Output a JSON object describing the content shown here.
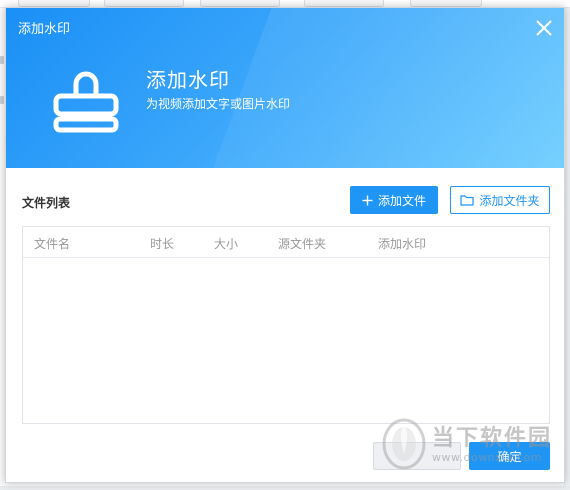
{
  "dialog": {
    "title": "添加水印",
    "heading": "添加水印",
    "subtitle": "为视频添加文字或图片水印",
    "close_icon": "close-icon",
    "hero_icon": "stamp-icon"
  },
  "files": {
    "section_label": "文件列表",
    "add_file_label": "添加文件",
    "add_file_icon": "plus-icon",
    "add_folder_label": "添加文件夹",
    "add_folder_icon": "folder-icon",
    "columns": [
      "文件名",
      "时长",
      "大小",
      "源文件夹",
      "添加水印"
    ],
    "rows": []
  },
  "footer": {
    "confirm_label": "确定"
  },
  "watermark": {
    "text": "当下软件园",
    "url": "www.downxia.com"
  },
  "colors": {
    "accent": "#1f95f5",
    "hero_start": "#1a8ff6",
    "hero_end": "#74cffe"
  }
}
